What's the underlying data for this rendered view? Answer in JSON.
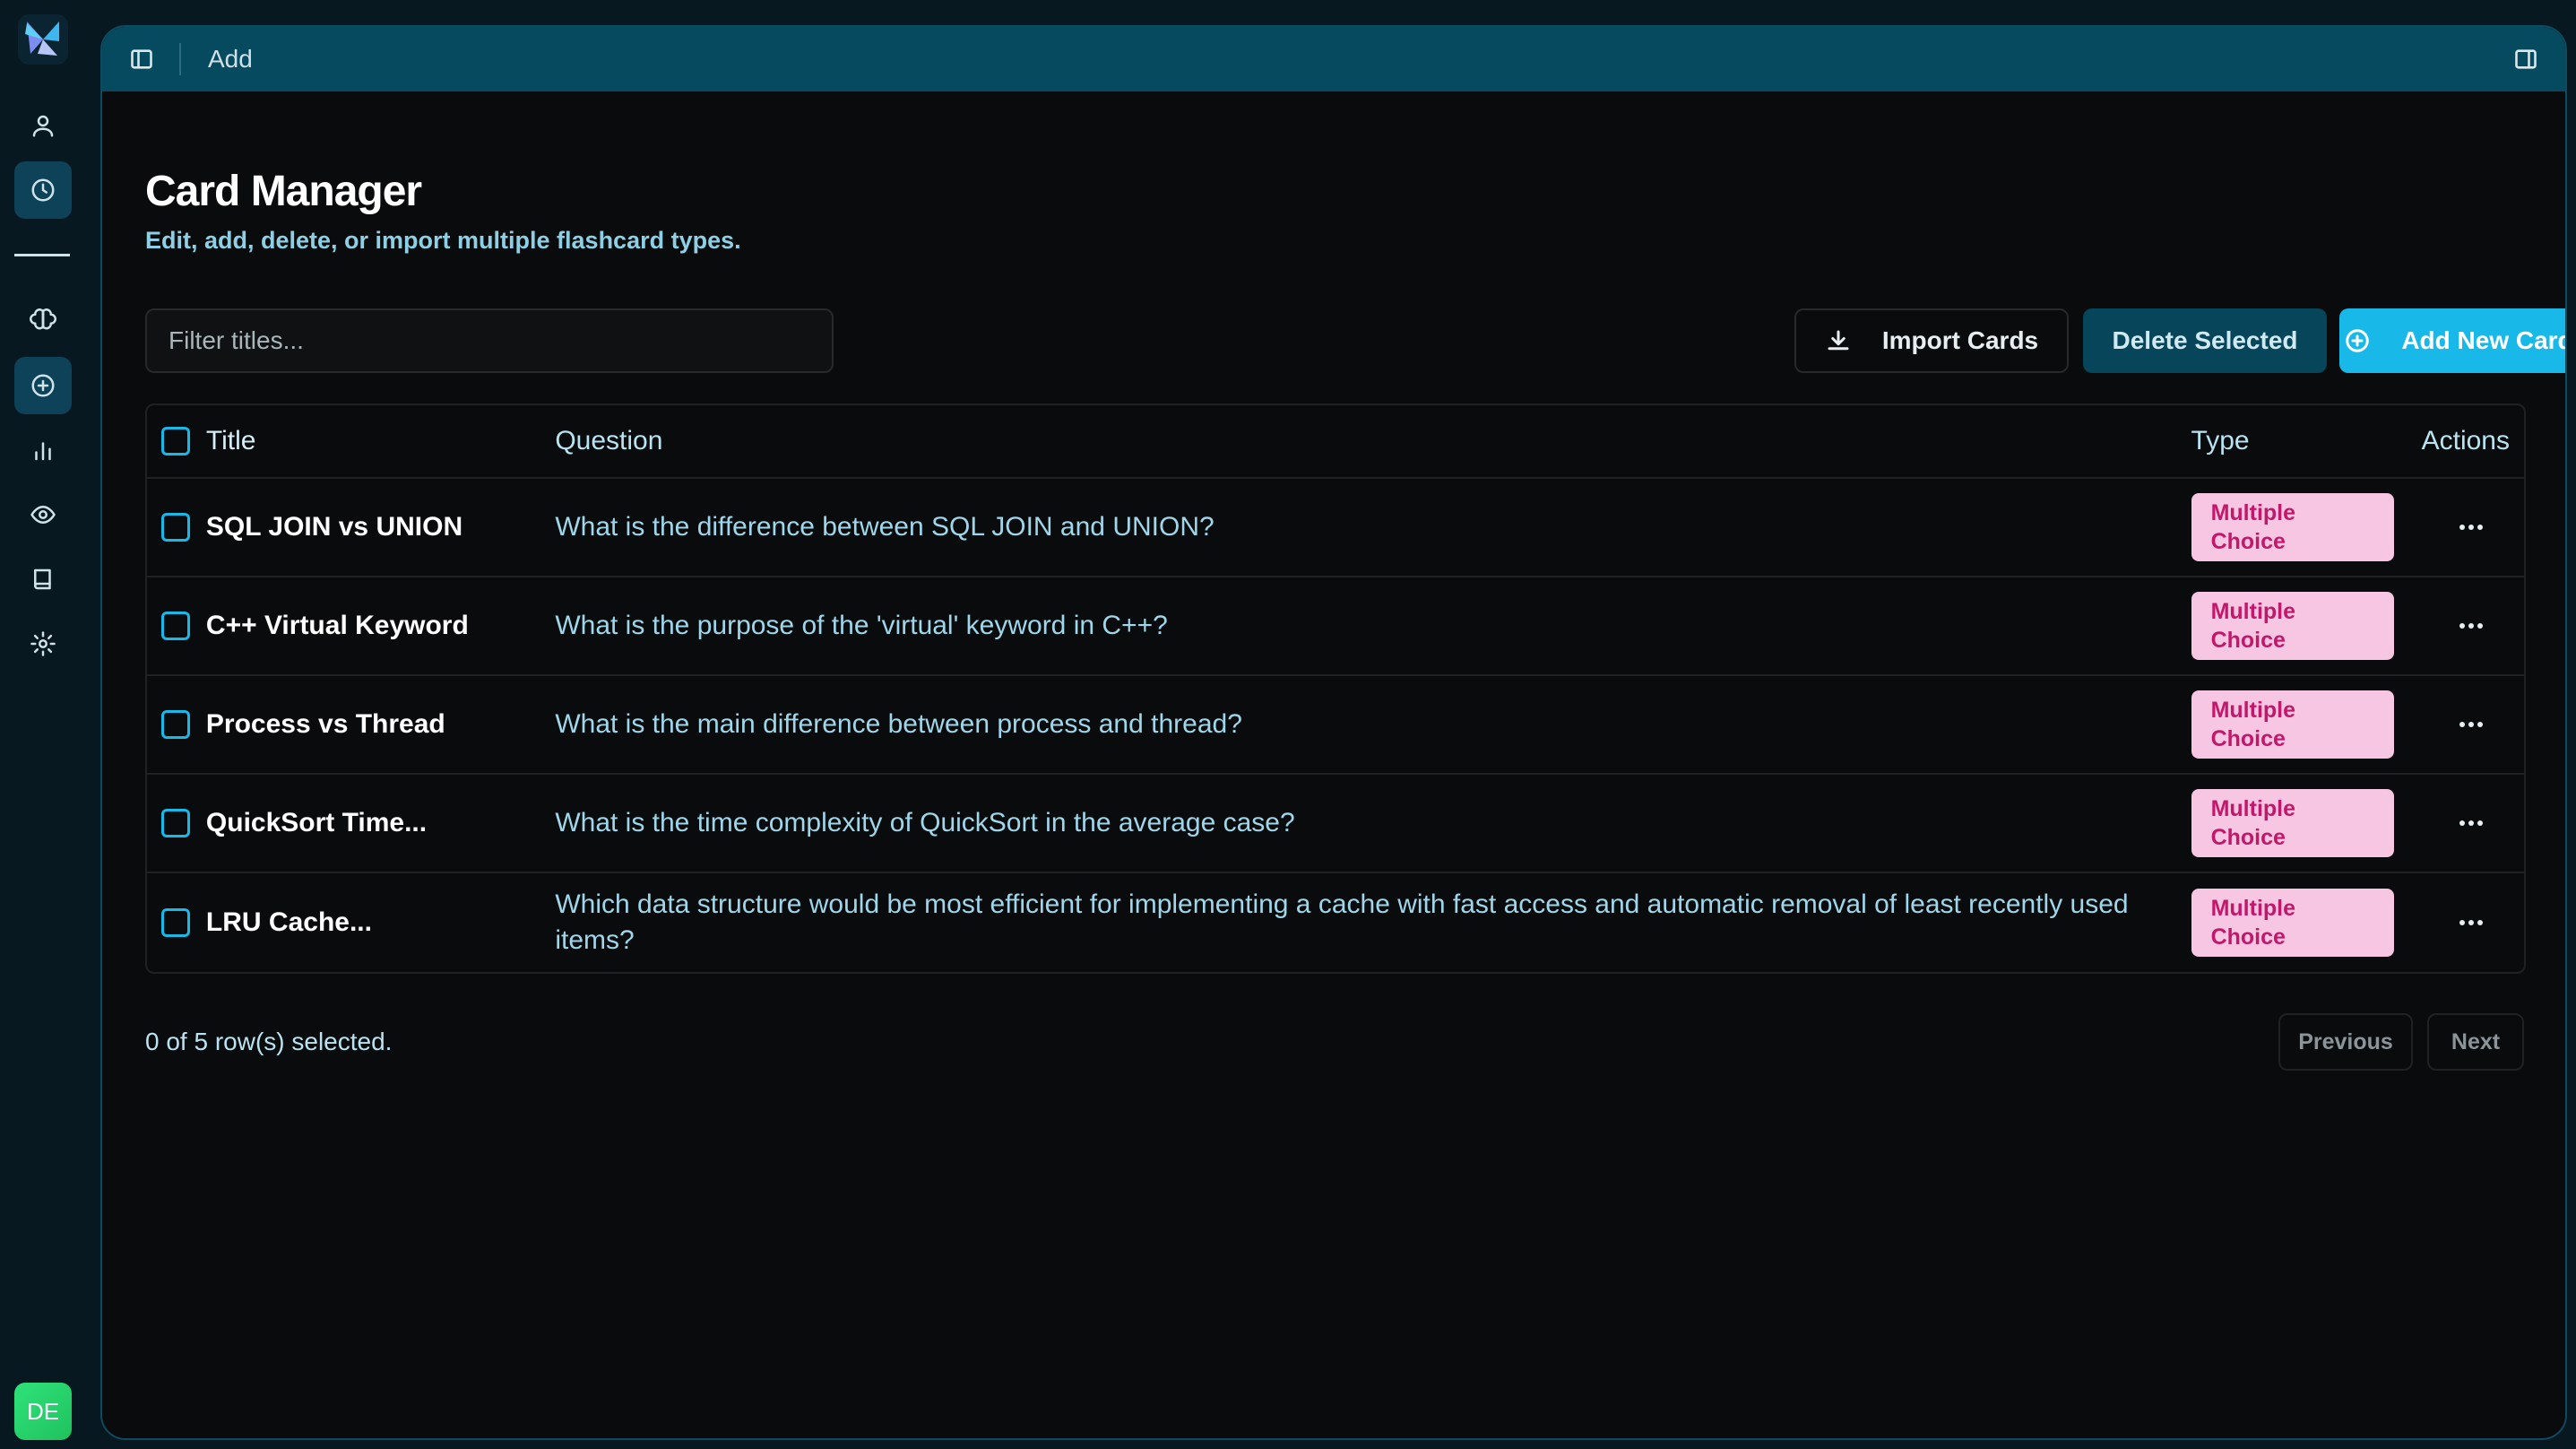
{
  "header": {
    "breadcrumb": "Add"
  },
  "page": {
    "title": "Card Manager",
    "subtitle": "Edit, add, delete, or import multiple flashcard types."
  },
  "toolbar": {
    "filter_placeholder": "Filter titles...",
    "import_label": "Import Cards",
    "delete_label": "Delete Selected",
    "add_label": "Add New Card"
  },
  "table": {
    "columns": {
      "title": "Title",
      "question": "Question",
      "type": "Type",
      "actions": "Actions"
    },
    "rows": [
      {
        "title": "SQL JOIN vs UNION",
        "question": "What is the difference between SQL JOIN and UNION?",
        "type_line1": "Multiple",
        "type_line2": "Choice"
      },
      {
        "title": "C++ Virtual Keyword",
        "question": "What is the purpose of the 'virtual' keyword in C++?",
        "type_line1": "Multiple",
        "type_line2": "Choice"
      },
      {
        "title": "Process vs Thread",
        "question": "What is the main difference between process and thread?",
        "type_line1": "Multiple",
        "type_line2": "Choice"
      },
      {
        "title": "QuickSort Time...",
        "question": "What is the time complexity of QuickSort in the average case?",
        "type_line1": "Multiple",
        "type_line2": "Choice"
      },
      {
        "title": "LRU Cache...",
        "question": "Which data structure would be most efficient for implementing a cache with fast access and automatic removal of least recently used items?",
        "type_line1": "Multiple",
        "type_line2": "Choice"
      }
    ]
  },
  "footer": {
    "selection": "0 of 5 row(s) selected.",
    "previous": "Previous",
    "next": "Next"
  },
  "user": {
    "initials": "DE"
  },
  "colors": {
    "accent": "#18b8e8",
    "badge_bg": "#f7c6e2",
    "badge_text": "#c2186b",
    "topbar": "#064a60"
  },
  "icons": [
    "logo",
    "user-icon",
    "clock-icon",
    "brain-icon",
    "plus-circle-icon",
    "bar-chart-icon",
    "eye-icon",
    "book-icon",
    "gear-icon",
    "sidebar-toggle-icon",
    "panel-right-icon",
    "download-icon",
    "more-icon"
  ]
}
